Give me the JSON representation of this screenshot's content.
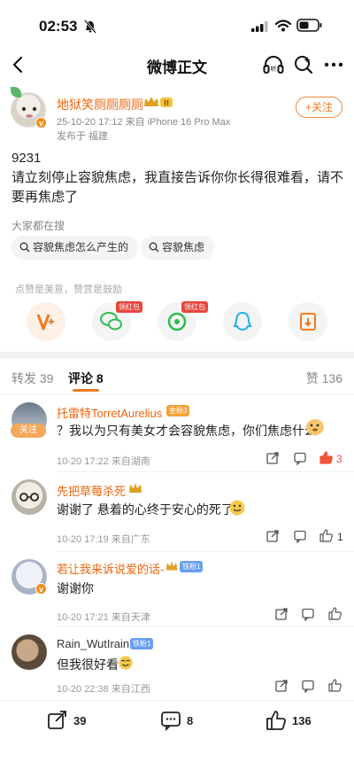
{
  "status_bar": {
    "time": "02:53"
  },
  "nav": {
    "title": "微博正文",
    "back_icon": "chevron-left-icon",
    "listen_icon": "headphones-icon",
    "search_icon": "search-icon",
    "more_icon": "more-icon"
  },
  "post": {
    "username": "地狱笑厕厕厕厕",
    "level": "II",
    "time_device": "25-10-20 17:12  来自 iPhone 16 Pro Max",
    "location": "发布于 福建",
    "follow_label": "+关注",
    "body_line1": "9231",
    "body_line2": "请立刻停止容貌焦虑，我直接告诉你你长得很难看，请不要再焦虑了"
  },
  "search": {
    "label": "大家都在搜",
    "chips": [
      "容貌焦虑怎么产生的",
      "容貌焦虑"
    ]
  },
  "reward": {
    "label": "点赞是美意，赞赏是鼓励",
    "red_packet_tag": "领红包"
  },
  "tabs": {
    "repost": "转发 39",
    "comment": "评论 8",
    "like": "赞 136"
  },
  "comments": [
    {
      "name": "托雷特TorretAurelius",
      "badge": "金粉3",
      "follow": "关注",
      "text": "？我以为只有美女才会容貌焦虑，你们焦虑什么",
      "meta": "10-20 17:22  来自湖南",
      "likes": "3",
      "liked": true
    },
    {
      "name": "先把草莓杀死",
      "badge": "",
      "text": "谢谢了 悬着的心终于安心的死了",
      "meta": "10-20 17:19  来自广东",
      "likes": "1",
      "liked": false
    },
    {
      "name": "若让我来诉说爱的话-",
      "badge": "铁粉1",
      "text": "谢谢你",
      "meta": "10-20 17:21  来自天津",
      "likes": "",
      "liked": false
    },
    {
      "name": "Rain_WutIrain",
      "badge": "铁粉1",
      "text": "但我很好看",
      "meta": "10-20 22:38  来自江西",
      "likes": "",
      "liked": false
    }
  ],
  "bottom": {
    "repost": "39",
    "comment": "8",
    "like": "136"
  },
  "colors": {
    "accent": "#f07a20",
    "username": "#f0650d",
    "liked": "#f2553a"
  }
}
